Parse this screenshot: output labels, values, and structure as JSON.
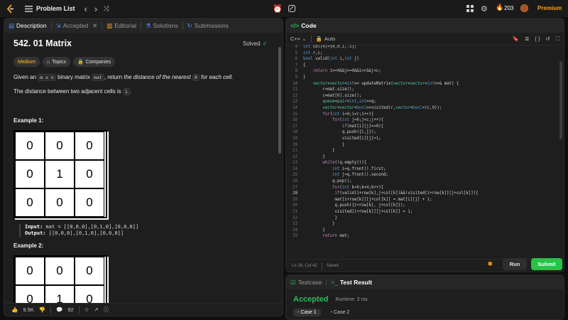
{
  "topbar": {
    "nav_label": "Problem List",
    "streak": "203",
    "premium": "Premium"
  },
  "left": {
    "tabs": [
      {
        "label": "Description"
      },
      {
        "label": "Accepted"
      },
      {
        "label": "Editorial"
      },
      {
        "label": "Solutions"
      },
      {
        "label": "Submissions"
      }
    ],
    "title": "542. 01 Matrix",
    "solved": "Solved",
    "tags": {
      "difficulty": "Medium",
      "topics": "Topics",
      "companies": "Companies"
    },
    "desc": {
      "p1_a": "Given an ",
      "p1_code1": "m x n",
      "p1_b": " binary matrix ",
      "p1_code2": "mat",
      "p1_c": ", return ",
      "p1_d": "the distance of the nearest ",
      "p1_code3": "0",
      "p1_e": " for each cell.",
      "p2_a": "The distance between two adjacent cells is ",
      "p2_code": "1",
      "p2_b": "."
    },
    "example1": {
      "heading": "Example 1:",
      "grid": [
        [
          "0",
          "0",
          "0"
        ],
        [
          "0",
          "1",
          "0"
        ],
        [
          "0",
          "0",
          "0"
        ]
      ],
      "input_label": "Input:",
      "input_value": "mat = [[0,0,0],[0,1,0],[0,0,0]]",
      "output_label": "Output:",
      "output_value": "[[0,0,0],[0,1,0],[0,0,0]]"
    },
    "example2": {
      "heading": "Example 2:",
      "grid": [
        [
          "0",
          "0",
          "0"
        ],
        [
          "0",
          "1",
          "0"
        ]
      ]
    },
    "footer": {
      "likes": "9.5K",
      "comments": "92"
    }
  },
  "right": {
    "code_title": "Code",
    "lang": "C++",
    "mode": "Auto",
    "status": {
      "cursor": "Ln 28, Col 42",
      "saved": "Saved"
    },
    "run": "Run",
    "submit": "Submit",
    "testcase_tab": "Testcase",
    "result_tab": "Test Result",
    "result": {
      "status": "Accepted",
      "runtime": "Runtime: 3 ms",
      "cases": [
        "Case 1",
        "Case 2"
      ]
    },
    "current_line": "28",
    "code_lines": [
      {
        "n": "4",
        "t": "int col[4]={0,0,1,-1};"
      },
      {
        "n": "5",
        "t": "int r,c;"
      },
      {
        "n": "6",
        "t": "bool valid(int i,int j)"
      },
      {
        "n": "7",
        "t": "{"
      },
      {
        "n": "8",
        "t": "    return i>=0&&j>=0&&i<r&&j<c;"
      },
      {
        "n": "9",
        "t": "}"
      },
      {
        "n": "10",
        "t": "    vector<vector<int>> updateMatrix(vector<vector<int>>& mat) {"
      },
      {
        "n": "11",
        "t": "        r=mat.size();"
      },
      {
        "n": "12",
        "t": "        c=mat[0].size();"
      },
      {
        "n": "13",
        "t": "        queue<pair<int,int>>q;"
      },
      {
        "n": "14",
        "t": "        vector<vector<bool>>visited(r,vector<bool>(c,0));"
      },
      {
        "n": "15",
        "t": "        for(int i=0;i<r;i++){"
      },
      {
        "n": "16",
        "t": "            for(int j=0;j<c;j++){"
      },
      {
        "n": "17",
        "t": "                if(mat[i][j]==0){"
      },
      {
        "n": "18",
        "t": "                q.push({i,j});"
      },
      {
        "n": "19",
        "t": "                visited[i][j]=1;"
      },
      {
        "n": "20",
        "t": "                }"
      },
      {
        "n": "21",
        "t": "            }"
      },
      {
        "n": "22",
        "t": "        }"
      },
      {
        "n": "23",
        "t": "        while(!q.empty()){"
      },
      {
        "n": "24",
        "t": "            int i=q.front().first;"
      },
      {
        "n": "25",
        "t": "            int j=q.front().second;"
      },
      {
        "n": "26",
        "t": "            q.pop();"
      },
      {
        "n": "27",
        "t": "            for(int k=0;k<4;k++){"
      },
      {
        "n": "28",
        "t": "             if(valid(i+row[k],j+col[k])&&!visited[i+row[k]][j+col[k]]){"
      },
      {
        "n": "29",
        "t": "             mat[i+row[k]][j+col[k]] = mat[i][j] + 1;"
      },
      {
        "n": "30",
        "t": "             q.push({i+row[k], j+col[k]});"
      },
      {
        "n": "31",
        "t": "             visited[i+row[k]][j+col[k]] = 1;"
      },
      {
        "n": "32",
        "t": "             }"
      },
      {
        "n": "33",
        "t": "            }"
      },
      {
        "n": "34",
        "t": "        }"
      },
      {
        "n": "35",
        "t": "        return mat;"
      }
    ]
  }
}
